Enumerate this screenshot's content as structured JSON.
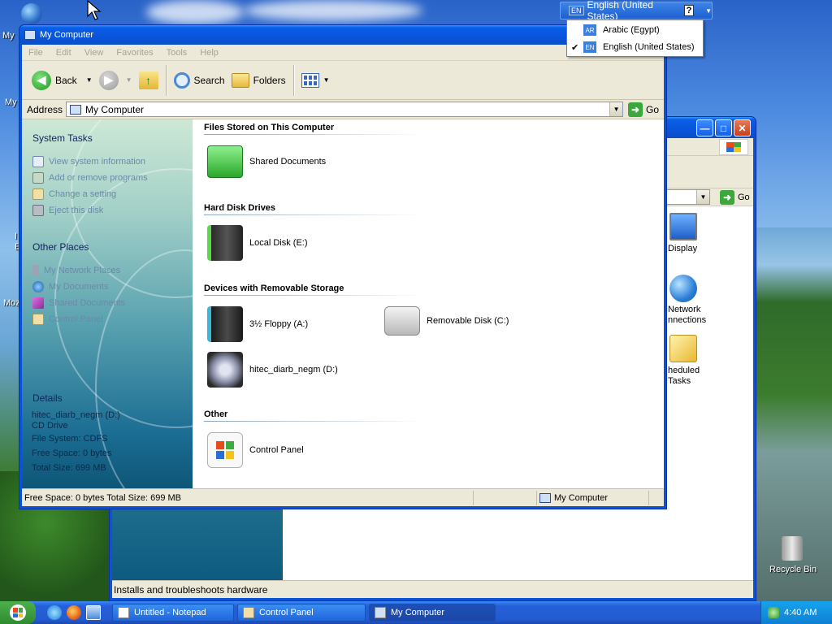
{
  "desktop": {
    "icons": [
      {
        "label": "My"
      },
      {
        "label": "My"
      },
      {
        "label": "I"
      },
      {
        "label": "E"
      },
      {
        "label": "Moz"
      }
    ],
    "recycle_bin": "Recycle Bin"
  },
  "back_window": {
    "caption_buttons": {
      "min": "—",
      "max": "□",
      "close": "✕"
    },
    "go_label": "Go",
    "icons": [
      {
        "label": "Display"
      },
      {
        "label": "Network\nConnections",
        "l1": "Network",
        "l2": "nnections"
      },
      {
        "label": "Scheduled Tasks",
        "l1": "heduled",
        "l2": "Tasks"
      }
    ],
    "status": "Installs and troubleshoots hardware"
  },
  "window": {
    "title": "My Computer",
    "menu": [
      "File",
      "Edit",
      "View",
      "Favorites",
      "Tools",
      "Help"
    ],
    "toolbar": {
      "back": "Back",
      "search": "Search",
      "folders": "Folders"
    },
    "address": {
      "label": "Address",
      "value": "My Computer",
      "go": "Go"
    },
    "system_tasks": {
      "title": "System Tasks",
      "items": [
        "View system information",
        "Add or remove programs",
        "Change a setting",
        "Eject this disk"
      ]
    },
    "other_places": {
      "title": "Other Places",
      "items": [
        "My Network Places",
        "My Documents",
        "Shared Documents",
        "Control Panel"
      ]
    },
    "details": {
      "title": "Details",
      "lines": [
        "hitec_diarb_negm (D:)",
        "CD Drive",
        "File System: CDFS",
        "Free Space: 0 bytes",
        "Total Size: 699 MB"
      ]
    },
    "groups": {
      "files": {
        "title": "Files Stored on This Computer",
        "items": [
          "Shared Documents"
        ]
      },
      "hdd": {
        "title": "Hard Disk Drives",
        "items": [
          "Local Disk (E:)"
        ]
      },
      "removable": {
        "title": "Devices with Removable Storage",
        "items": [
          "3½ Floppy (A:)",
          "Removable Disk (C:)",
          "hitec_diarb_negm (D:)"
        ]
      },
      "other": {
        "title": "Other",
        "items": [
          "Control Panel"
        ]
      }
    },
    "status": {
      "left": "Free Space: 0 bytes Total Size: 699 MB",
      "right": "My Computer"
    }
  },
  "language_bar": {
    "code": "EN",
    "current": "English (United States)",
    "help": "?",
    "menu": [
      {
        "code": "AR",
        "label": "Arabic (Egypt)",
        "checked": false
      },
      {
        "code": "EN",
        "label": "English (United States)",
        "checked": true
      }
    ]
  },
  "taskbar": {
    "tasks": [
      "Untitled - Notepad",
      "Control Panel",
      "My Computer"
    ],
    "clock": "4:40 AM"
  },
  "colors": {
    "xp_blue": "#0854db",
    "taskbar_tray": "#0f7fd4",
    "start_green": "#2f8a2f"
  }
}
